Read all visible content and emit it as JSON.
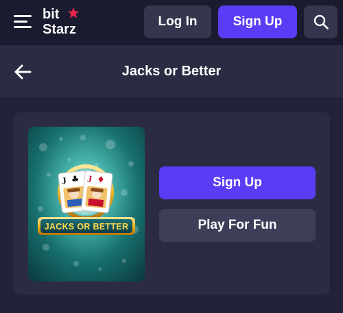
{
  "header": {
    "logo": {
      "line1": "bit",
      "line2": "Starz"
    },
    "login_label": "Log In",
    "signup_label": "Sign Up"
  },
  "subheader": {
    "title": "Jacks or Better"
  },
  "game": {
    "thumbnail_logo": "JACKS OR BETTER",
    "card_rank": "J",
    "signup_label": "Sign Up",
    "play_label": "Play For Fun"
  },
  "icons": {
    "menu": "hamburger-menu-icon",
    "star": "star-icon",
    "search": "search-icon",
    "back": "back-arrow-icon"
  },
  "colors": {
    "background": "#22233a",
    "topbar": "#1a1b2e",
    "panel": "#2b2c43",
    "accent": "#5a3cf5",
    "secondary_button": "#34364d",
    "star": "#e8264c",
    "thumbnail_teal": "#1f8a86",
    "thumbnail_gold": "#f2b51d"
  }
}
